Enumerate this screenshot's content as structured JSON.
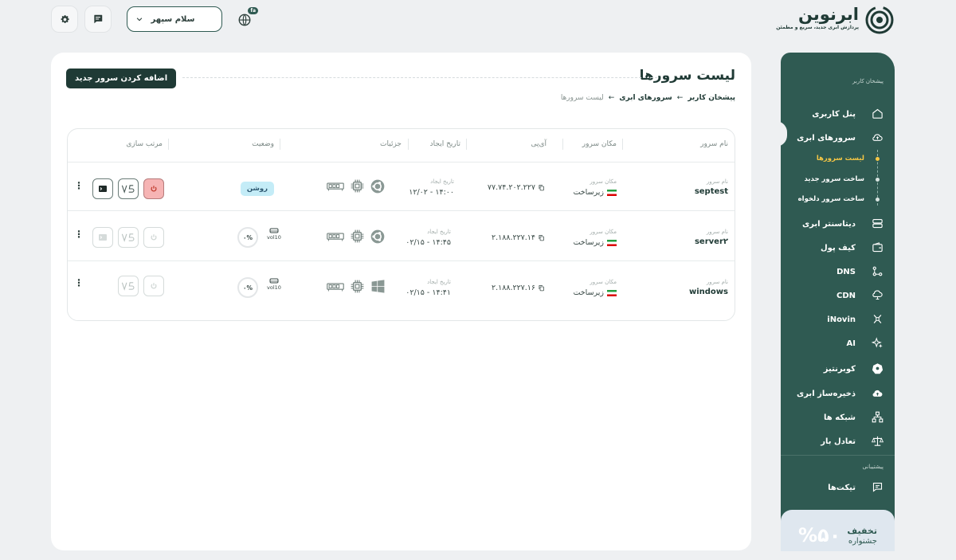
{
  "header": {
    "brand": "ابرنوین",
    "tagline": "پردازش ابری جدید، سریع و مطمئن",
    "user_greeting": "سلام سپهر",
    "lang_badge": "fa"
  },
  "sidebar": {
    "section_user": "پیشخان کاربر",
    "items": [
      {
        "label": "پنل کاربری",
        "icon": "home-icon"
      },
      {
        "label": "سرورهای ابری",
        "icon": "cloud-icon"
      },
      {
        "label": "دیتاسنتر ابری",
        "icon": "datacenter-icon"
      },
      {
        "label": "کیف پول",
        "icon": "wallet-icon"
      },
      {
        "label": "DNS",
        "icon": "dns-icon"
      },
      {
        "label": "CDN",
        "icon": "cdn-icon"
      },
      {
        "label": "iNovin",
        "icon": "inovin-icon"
      },
      {
        "label": "AI",
        "icon": "ai-sparkle-icon"
      },
      {
        "label": "کوبرنتیز",
        "icon": "kubernetes-icon"
      },
      {
        "label": "ذخیره‌ساز ابری",
        "icon": "cloud-storage-icon"
      },
      {
        "label": "شبکه ها",
        "icon": "network-icon"
      },
      {
        "label": "تعادل بار",
        "icon": "balance-icon"
      }
    ],
    "subitems": [
      {
        "label": "لیست سرورها",
        "active": true
      },
      {
        "label": "ساخت سرور جدید",
        "active": false
      },
      {
        "label": "ساخت سرور دلخواه",
        "active": false
      }
    ],
    "section_support": "پیشتیبانی",
    "support_item": "تیکت‌ها",
    "promo_percent": "%۵۰",
    "promo_title": "تخفیف",
    "promo_subtitle": "جشنواره"
  },
  "main": {
    "title": "لیست سرورها",
    "add_button": "اضافه کردن سرور جدید",
    "breadcrumbs": [
      "پیشخان کاربر",
      "سرورهای ابری",
      "لیست سرورها"
    ],
    "columns": {
      "name": "نام سرور",
      "location": "مکان سرور",
      "ip": "آی‌پی",
      "created": "تاریخ ایجاد",
      "details": "جزئیات",
      "status": "وضعیت",
      "sort": "مرتب سازی"
    },
    "cell_labels": {
      "name": "نام سرور",
      "location": "مکان سرور",
      "created": "تاریخ ایجاد"
    },
    "rows": [
      {
        "name": "septest",
        "location": "زیرساخت",
        "ip": "۷۷.۷۴.۲۰۲.۲۲۷",
        "created": "۱۴:۰۰ - ۱۲/۰۲",
        "status": "روشن",
        "os": "ubuntu"
      },
      {
        "name": "server۲",
        "location": "زیرساخت",
        "ip": "۲.۱۸۸.۲۲۷.۱۴",
        "created": "۱۴:۴۵ - ۰۲/۱۵",
        "progress": "۰%",
        "volume": "vol10",
        "os": "ubuntu"
      },
      {
        "name": "windows",
        "location": "زیرساخت",
        "ip": "۲.۱۸۸.۲۲۷.۱۶",
        "created": "۱۴:۴۱ - ۰۲/۱۵",
        "progress": "۰%",
        "volume": "vol10",
        "os": "windows"
      }
    ]
  },
  "colors": {
    "primary": "#2f5a52",
    "dark": "#1f3a35",
    "accent": "#f6c744",
    "status_on_bg": "#c4ecf7",
    "power_on_bg": "#f6b4b4"
  }
}
